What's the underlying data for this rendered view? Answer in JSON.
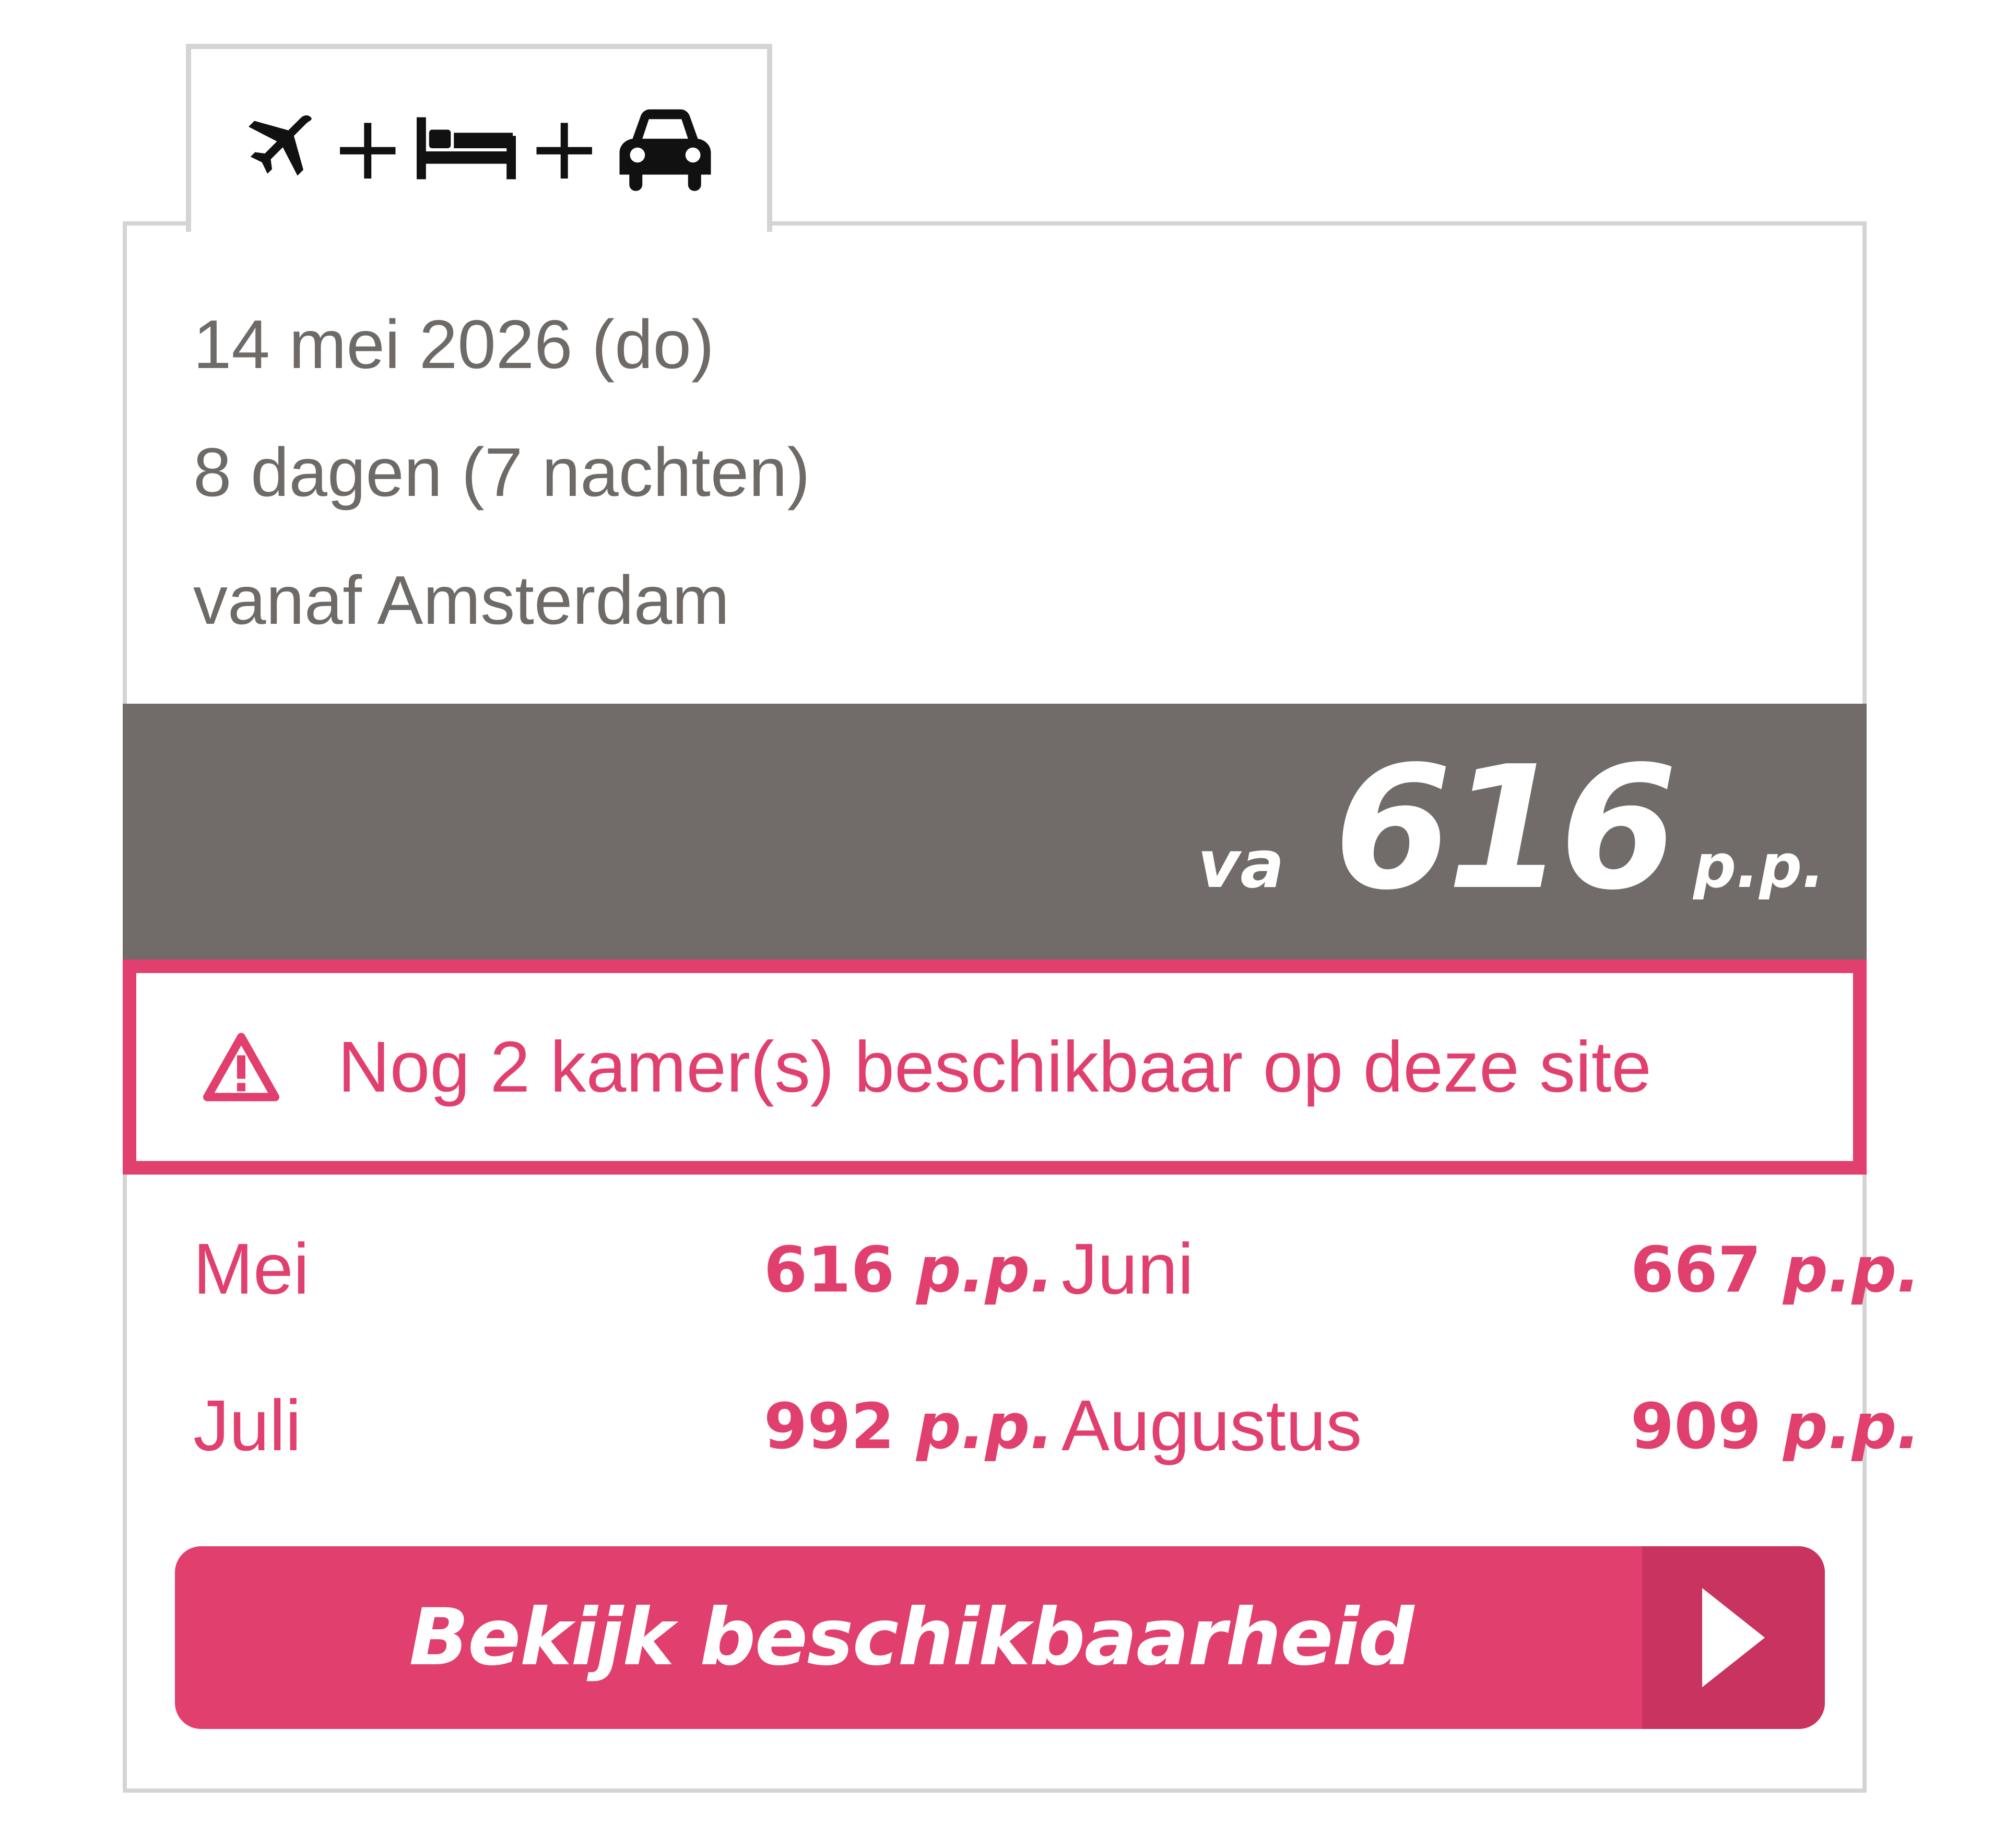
{
  "tab": {
    "icons": [
      "plane-icon",
      "bed-icon",
      "car-icon"
    ],
    "separator": "+"
  },
  "info": {
    "date": "14 mei 2026 (do)",
    "duration": "8 dagen (7 nachten)",
    "departure": "vanaf Amsterdam"
  },
  "price": {
    "prefix": "va",
    "amount": "616",
    "suffix": "p.p."
  },
  "alert": {
    "icon": "warning-icon",
    "text": "Nog 2 kamer(s) beschikbaar op deze site"
  },
  "months": [
    {
      "name": "Mei",
      "price": "616",
      "suffix": "p.p."
    },
    {
      "name": "Juni",
      "price": "667",
      "suffix": "p.p."
    },
    {
      "name": "Juli",
      "price": "992",
      "suffix": "p.p."
    },
    {
      "name": "Augustus",
      "price": "909",
      "suffix": "p.p."
    }
  ],
  "cta": {
    "label": "Bekijk beschikbaarheid",
    "icon": "play-arrow-icon"
  },
  "colors": {
    "accent": "#e13f6e",
    "accent_dark": "#c8345f",
    "price_bar": "#716c69",
    "text_gray": "#6e6a67",
    "border": "#d4d4d4"
  }
}
